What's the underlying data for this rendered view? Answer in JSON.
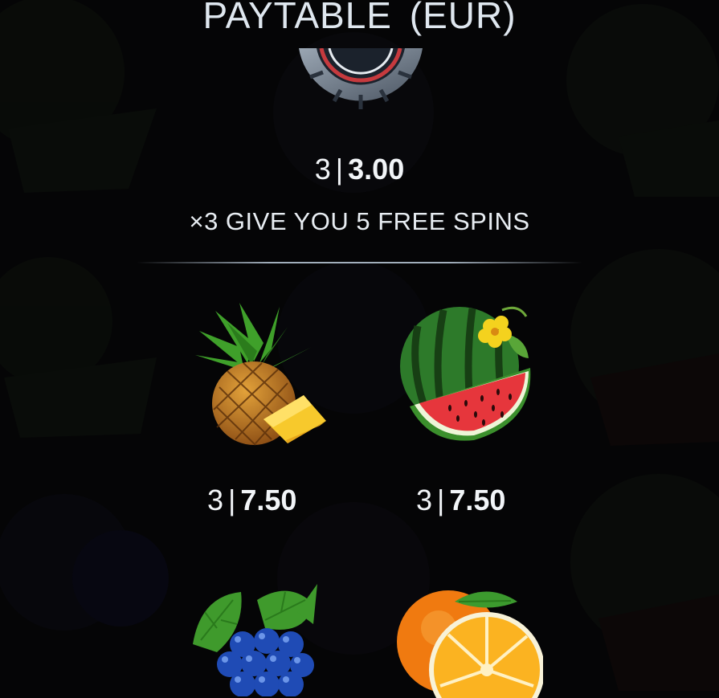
{
  "paytable": {
    "title": "PAYTABLE  (EUR)",
    "scatter": {
      "icon": "casino-chip-icon",
      "count": "3",
      "separator": "|",
      "amount": "3.00",
      "feature_text": "×3 GIVE YOU 5 FREE SPINS"
    },
    "symbols": [
      {
        "icon": "pineapple-icon",
        "count": "3",
        "separator": "|",
        "amount": "7.50"
      },
      {
        "icon": "watermelon-icon",
        "count": "3",
        "separator": "|",
        "amount": "7.50"
      },
      {
        "icon": "grapes-icon"
      },
      {
        "icon": "orange-icon"
      }
    ]
  },
  "colors": {
    "background": "#050506",
    "text": "#f2f5f8",
    "divider": "#bccbd9"
  }
}
